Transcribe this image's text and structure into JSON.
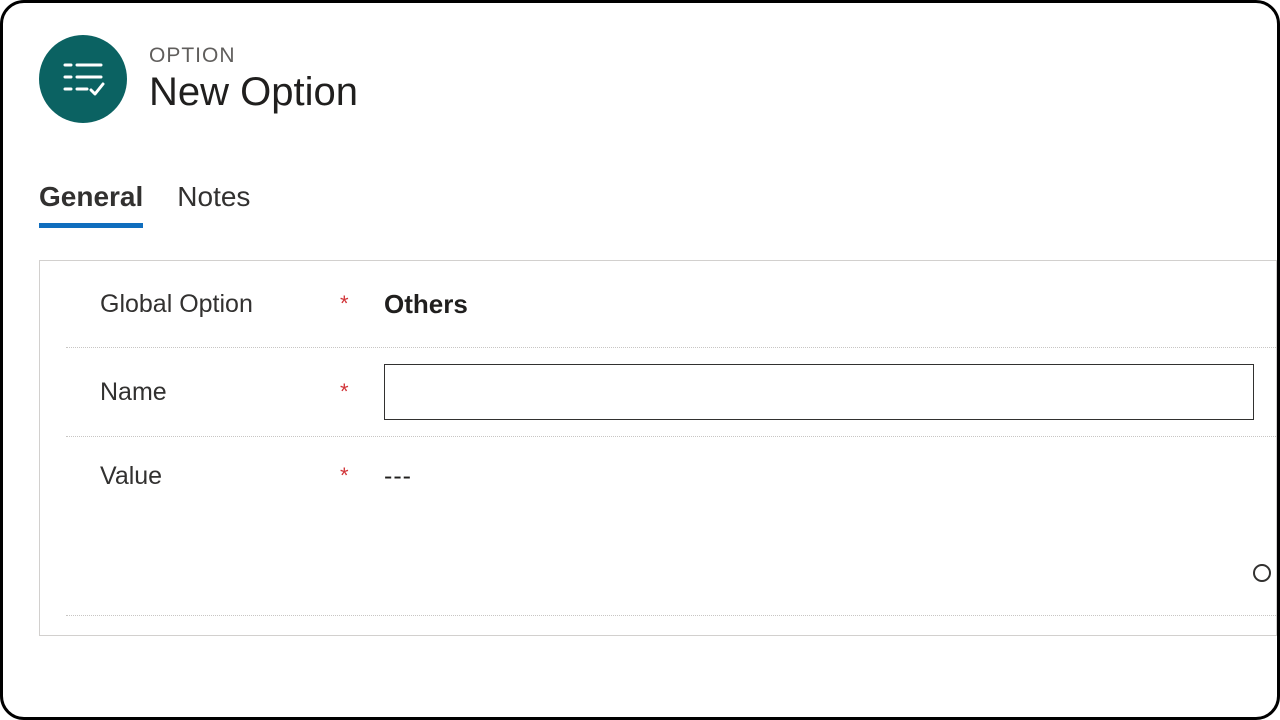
{
  "header": {
    "entity_type_label": "OPTION",
    "title": "New Option"
  },
  "tabs": {
    "general": "General",
    "notes": "Notes",
    "active": "general"
  },
  "form": {
    "global_option": {
      "label": "Global Option",
      "required_mark": "*",
      "value": "Others"
    },
    "name": {
      "label": "Name",
      "required_mark": "*",
      "value": ""
    },
    "value_field": {
      "label": "Value",
      "required_mark": "*",
      "value": "---"
    }
  }
}
